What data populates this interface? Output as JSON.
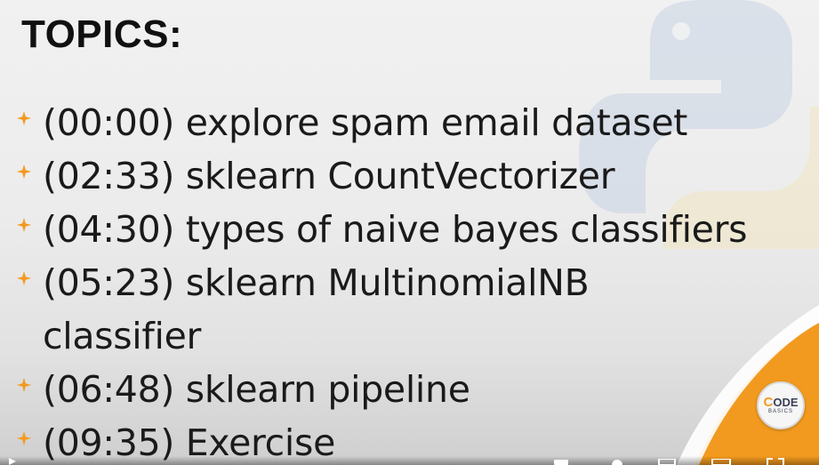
{
  "slide": {
    "title": "TOPICS:",
    "bullet_icon": "four-point-star-icon",
    "topics": [
      {
        "time": "(00:00)",
        "text": "explore spam email dataset"
      },
      {
        "time": "(02:33)",
        "text": "sklearn CountVectorizer"
      },
      {
        "time": "(04:30)",
        "text": "types of naive bayes classifiers"
      },
      {
        "time": "(05:23)",
        "text": "sklearn MultinomialNB classifier"
      },
      {
        "time": "(06:48)",
        "text": "sklearn pipeline"
      },
      {
        "time": "(09:35)",
        "text": "Exercise"
      }
    ]
  },
  "logo": {
    "letter_c": "C",
    "letters": "ODE",
    "subtitle": "BASICS"
  },
  "colors": {
    "accent_orange": "#f29a1f",
    "text": "#1a1a1a",
    "python_blue": "#c9d4e4",
    "python_yellow": "#f1e6c2"
  }
}
